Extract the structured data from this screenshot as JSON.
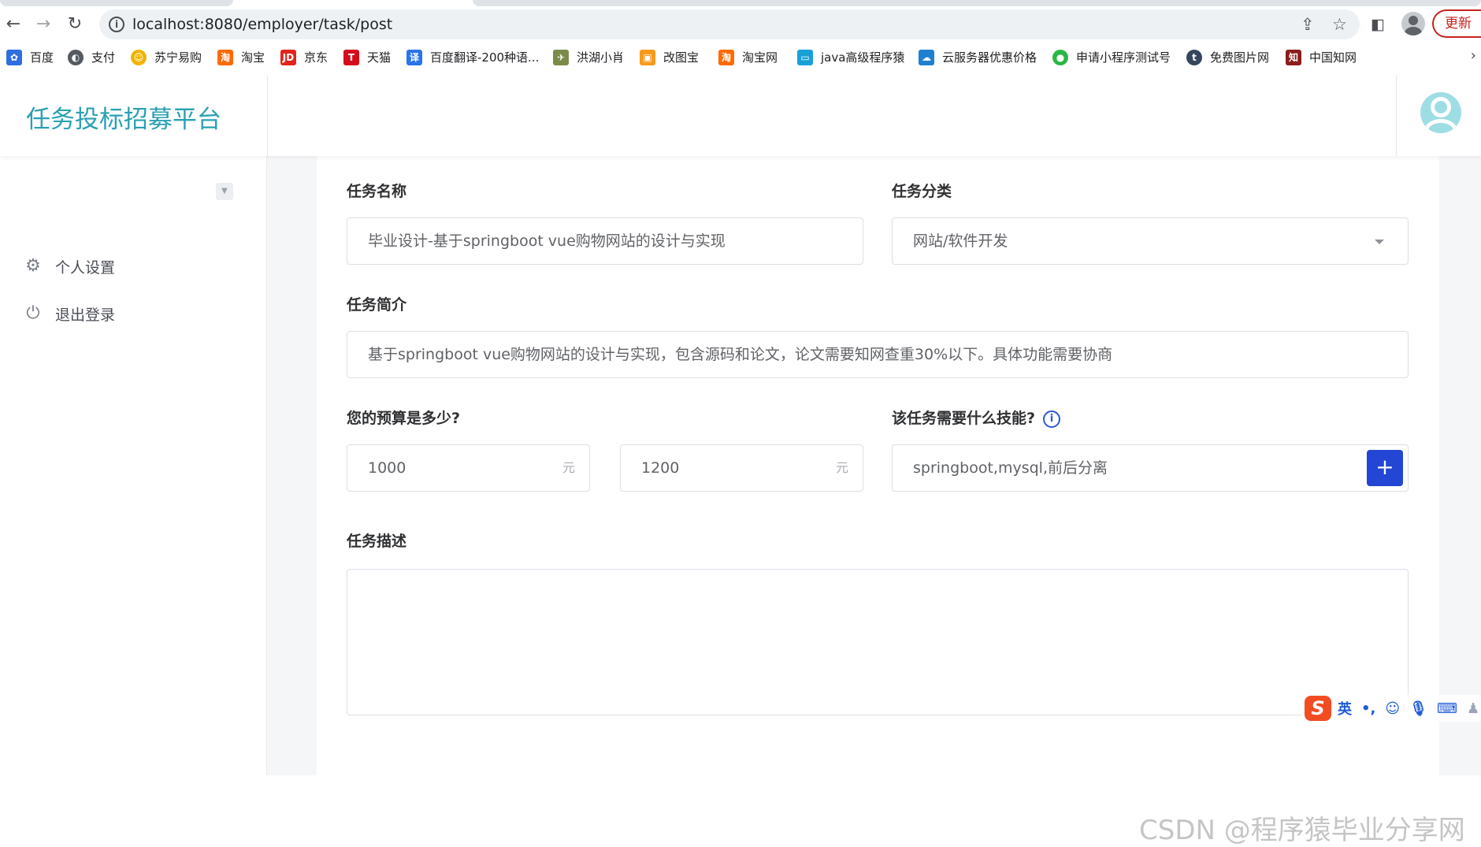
{
  "browser": {
    "url": "localhost:8080/employer/task/post",
    "update_label": "更新",
    "bookmarks": [
      {
        "label": "百度",
        "icon": "baidu-icon",
        "color": "#2f6ee0"
      },
      {
        "label": "支付",
        "icon": "globe-icon",
        "color": "#555a60"
      },
      {
        "label": "苏宁易购",
        "icon": "suning-icon",
        "color": "#f0b400"
      },
      {
        "label": "淘宝",
        "icon": "taobao-icon",
        "color": "#ff6a00"
      },
      {
        "label": "京东",
        "icon": "jd-icon",
        "color": "#e1251b"
      },
      {
        "label": "天猫",
        "icon": "tmall-icon",
        "color": "#d50b1c"
      },
      {
        "label": "百度翻译-200种语...",
        "icon": "translate-icon",
        "color": "#2a73e8"
      },
      {
        "label": "洪湖小肖",
        "icon": "bird-icon",
        "color": "#7d8b4a"
      },
      {
        "label": "改图宝",
        "icon": "gaitubao-icon",
        "color": "#f79a1c"
      },
      {
        "label": "淘宝网",
        "icon": "taobao-icon",
        "color": "#ff6a00"
      },
      {
        "label": "java高级程序猿",
        "icon": "bilibili-icon",
        "color": "#1aa0d8"
      },
      {
        "label": "云服务器优惠价格",
        "icon": "cloud-icon",
        "color": "#1e80d0"
      },
      {
        "label": "申请小程序测试号",
        "icon": "wechat-icon",
        "color": "#2ab743"
      },
      {
        "label": "免费图片网",
        "icon": "tumblr-icon",
        "color": "#35465c"
      },
      {
        "label": "中国知网",
        "icon": "cnki-icon",
        "color": "#8b1d1d"
      }
    ]
  },
  "app": {
    "title": "任务投标招募平台",
    "sidebar": {
      "items": [
        {
          "label": "个人设置",
          "icon": "gear-icon"
        },
        {
          "label": "退出登录",
          "icon": "power-icon"
        }
      ]
    },
    "form": {
      "task_name": {
        "label": "任务名称",
        "placeholder": "毕业设计-基于springboot vue购物网站的设计与实现"
      },
      "category": {
        "label": "任务分类",
        "placeholder": "网站/软件开发"
      },
      "intro": {
        "label": "任务简介",
        "placeholder": "基于springboot vue购物网站的设计与实现，包含源码和论文，论文需要知网查重30%以下。具体功能需要协商"
      },
      "budget": {
        "label": "您的预算是多少?",
        "min_placeholder": "1000",
        "max_placeholder": "1200",
        "unit": "元"
      },
      "skills": {
        "label": "该任务需要什么技能?",
        "value": "springboot,mysql,前后分离",
        "add_label": "+"
      },
      "description": {
        "label": "任务描述"
      }
    }
  },
  "ime": {
    "lang_label": "英"
  },
  "watermark": "CSDN @程序猿毕业分享网"
}
